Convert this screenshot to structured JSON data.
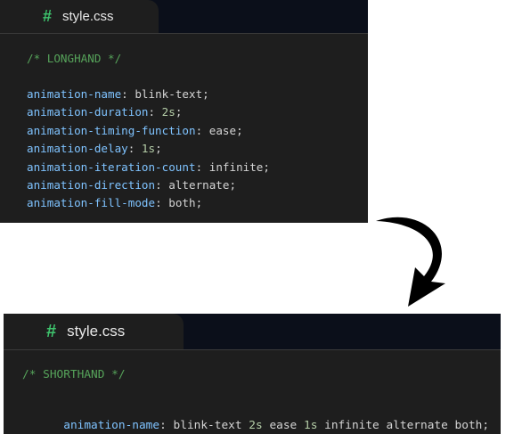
{
  "longhand": {
    "tab": {
      "icon": "#",
      "filename": "style.css"
    },
    "comment": "/* LONGHAND */",
    "lines": [
      {
        "prop": "animation-name",
        "value": "blink-text",
        "type": "plain"
      },
      {
        "prop": "animation-duration",
        "value": "2s",
        "type": "num"
      },
      {
        "prop": "animation-timing-function",
        "value": "ease",
        "type": "plain"
      },
      {
        "prop": "animation-delay",
        "value": "1s",
        "type": "num"
      },
      {
        "prop": "animation-iteration-count",
        "value": "infinite",
        "type": "plain"
      },
      {
        "prop": "animation-direction",
        "value": "alternate",
        "type": "plain"
      },
      {
        "prop": "animation-fill-mode",
        "value": "both",
        "type": "plain"
      }
    ]
  },
  "shorthand": {
    "tab": {
      "icon": "#",
      "filename": "style.css"
    },
    "comment": "/* SHORTHAND */",
    "line": {
      "prop": "animation-name",
      "tokens": [
        {
          "text": "blink-text",
          "type": "plain"
        },
        {
          "text": "2s",
          "type": "num"
        },
        {
          "text": "ease",
          "type": "plain"
        },
        {
          "text": "1s",
          "type": "num"
        },
        {
          "text": "infinite",
          "type": "plain"
        },
        {
          "text": "alternate",
          "type": "plain"
        },
        {
          "text": "both",
          "type": "plain"
        }
      ]
    }
  },
  "arrow_icon": "curved-arrow-down-icon",
  "colors": {
    "editor_bg": "#1e1e1e",
    "tabbar_bg": "#0b0f1a",
    "hash": "#3ec46d",
    "comment": "#56a35a",
    "property": "#7fc3ff",
    "number": "#b5cea8",
    "text": "#d4d4d4"
  }
}
